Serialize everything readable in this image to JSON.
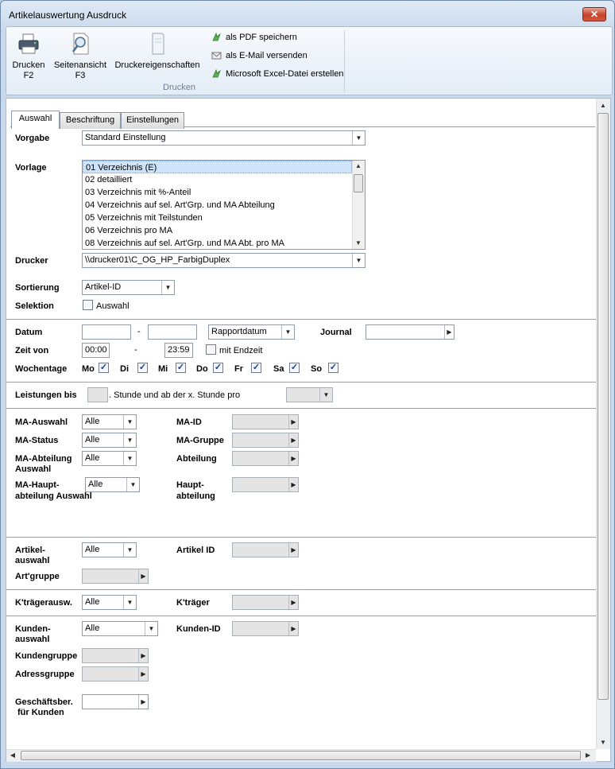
{
  "window": {
    "title": "Artikelauswertung Ausdruck",
    "close_label": "✕"
  },
  "ribbon": {
    "drucken": "Drucken\nF2",
    "drucken_l1": "Drucken",
    "drucken_l2": "F2",
    "seitenansicht_l1": "Seitenansicht",
    "seitenansicht_l2": "F3",
    "druckereigenschaften": "Druckereigenschaften",
    "pdf": "als PDF speichern",
    "email": "als E-Mail versenden",
    "excel": "Microsoft Excel-Datei erstellen",
    "group_label": "Drucken"
  },
  "tabs": [
    "Auswahl",
    "Beschriftung",
    "Einstellungen"
  ],
  "form": {
    "vorgabe_label": "Vorgabe",
    "vorgabe_value": "Standard Einstellung",
    "vorlage_label": "Vorlage",
    "vorlage_items": [
      "01 Verzeichnis (E)",
      "02 detailliert",
      "03 Verzeichnis mit %-Anteil",
      "04 Verzeichnis auf sel. Art'Grp. und MA Abteilung",
      "05 Verzeichnis mit Teilstunden",
      "06 Verzeichnis pro MA",
      "08 Verzeichnis auf sel. Art'Grp. und MA Abt. pro MA"
    ],
    "drucker_label": "Drucker",
    "drucker_value": "\\\\drucker01\\C_OG_HP_FarbigDuplex",
    "sortierung_label": "Sortierung",
    "sortierung_value": "Artikel-ID",
    "selektion_label": "Selektion",
    "selektion_cb_label": "Auswahl",
    "datum_label": "Datum",
    "datum_dash": "-",
    "datum_type": "Rapportdatum",
    "journal_label": "Journal",
    "zeit_label": "Zeit von",
    "zeit_von": "00:00",
    "zeit_dash": "-",
    "zeit_bis": "23:59",
    "mit_endzeit": "mit Endzeit",
    "wochentage_label": "Wochentage",
    "days": [
      "Mo",
      "Di",
      "Mi",
      "Do",
      "Fr",
      "Sa",
      "So"
    ],
    "leistungen_label": "Leistungen bis",
    "leistungen_text": ". Stunde und ab der x. Stunde pro",
    "ma_auswahl_label": "MA-Auswahl",
    "ma_status_label": "MA-Status",
    "ma_abteilung_label": "MA-Abteilung Auswahl",
    "ma_haupt_label": "MA-Haupt-abteilung Auswahl",
    "ma_haupt_l1": "MA-Haupt-",
    "ma_haupt_l2": "abteilung Auswahl",
    "ma_abt_l1": "MA-Abteilung",
    "ma_abt_l2": "Auswahl",
    "alle": "Alle",
    "ma_id_label": "MA-ID",
    "ma_gruppe_label": "MA-Gruppe",
    "abteilung_label": "Abteilung",
    "haupt_l1": "Haupt-",
    "haupt_l2": "abteilung",
    "artikel_l1": "Artikel-",
    "artikel_l2": "auswahl",
    "artikel_id_label": "Artikel ID",
    "artgruppe_label": "Art'gruppe",
    "ktraeger_ausw_label": "K'trägerausw.",
    "ktraeger_label": "K'träger",
    "kunden_l1": "Kunden-",
    "kunden_l2": "auswahl",
    "kunden_id_label": "Kunden-ID",
    "kundengruppe_label": "Kundengruppe",
    "adressgruppe_label": "Adressgruppe",
    "geschaefts_l1": "Geschäftsber.",
    "geschaefts_l2": "für Kunden"
  },
  "colors": {
    "accent": "#c9d9ec",
    "checkbox_mark": "#1d3f8a"
  },
  "icons": [
    "printer-icon",
    "magnifier-icon",
    "printer-properties-icon",
    "pdf-icon",
    "email-icon",
    "excel-icon"
  ]
}
